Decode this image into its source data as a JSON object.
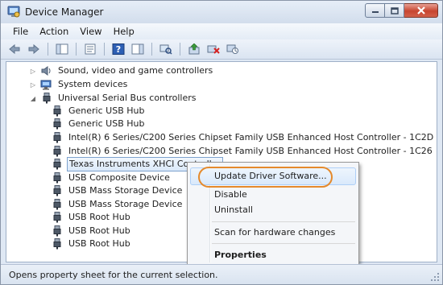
{
  "window": {
    "title": "Device Manager"
  },
  "menubar": {
    "items": [
      "File",
      "Action",
      "View",
      "Help"
    ]
  },
  "toolbar": {
    "icons": [
      "back-icon",
      "forward-icon",
      "show-hide-console-tree-icon",
      "properties-icon",
      "help-icon",
      "show-hide-action-pane-icon",
      "scan-hardware-icon",
      "update-driver-icon",
      "uninstall-icon",
      "disable-icon"
    ]
  },
  "tree": {
    "categories": [
      {
        "label": "Sound, video and game controllers",
        "expanded": false
      },
      {
        "label": "System devices",
        "expanded": false
      },
      {
        "label": "Universal Serial Bus controllers",
        "expanded": true
      }
    ],
    "usb_devices": [
      "Generic USB Hub",
      "Generic USB Hub",
      "Intel(R) 6 Series/C200 Series Chipset Family USB Enhanced Host Controller - 1C2D",
      "Intel(R) 6 Series/C200 Series Chipset Family USB Enhanced Host Controller - 1C26",
      "Texas Instruments XHCI Controller",
      "USB Composite Device",
      "USB Mass Storage Device",
      "USB Mass Storage Device",
      "USB Root Hub",
      "USB Root Hub",
      "USB Root Hub"
    ],
    "selected": "Texas Instruments XHCI Controller"
  },
  "context_menu": {
    "items": [
      "Update Driver Software...",
      "Disable",
      "Uninstall",
      "Scan for hardware changes",
      "Properties"
    ],
    "highlighted": "Update Driver Software...",
    "default_item": "Properties"
  },
  "statusbar": {
    "text": "Opens property sheet for the current selection."
  },
  "colors": {
    "highlight_ring": "#e58a2c",
    "selection": "#dbe9f9",
    "close_button": "#c7452f"
  }
}
